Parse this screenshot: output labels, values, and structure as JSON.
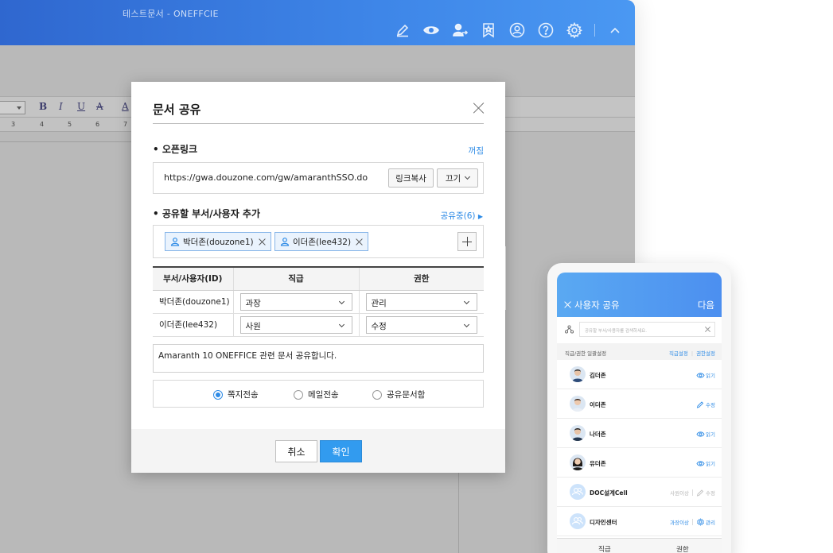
{
  "app": {
    "title": "테스트문서 - ONEFFCIE",
    "toolbar": {
      "bold": "B",
      "italic": "I",
      "underline": "U",
      "strike": "A",
      "font_color": "A"
    },
    "ruler_ticks": [
      "3",
      "4",
      "5",
      "6",
      "7"
    ],
    "header_icons": [
      "edit-icon",
      "view-icon",
      "share-user-icon",
      "bookmark-star-icon",
      "profile-icon",
      "help-icon",
      "settings-icon",
      "collapse-icon"
    ]
  },
  "dialog": {
    "title": "문서 공유",
    "open_link": {
      "label": "오픈링크",
      "status": "꺼짐",
      "url": "https://gwa.douzone.com/gw/amaranthSSO.do",
      "copy_button": "링크복사",
      "toggle_button": "끄기"
    },
    "add_section": {
      "label": "공유할 부서/사용자 추가",
      "sharing_status": "공유중(6)",
      "chips": [
        "박더존(douzone1)",
        "이더존(lee432)"
      ]
    },
    "table": {
      "headers": [
        "부서/사용자(ID)",
        "직급",
        "권한"
      ],
      "rows": [
        {
          "name": "박더존(douzone1)",
          "rank": "과장",
          "permission": "관리"
        },
        {
          "name": "이더존(lee432)",
          "rank": "사원",
          "permission": "수정"
        }
      ]
    },
    "message": "Amaranth 10 ONEFFICE 관련 문서 공유합니다.",
    "send_options": [
      {
        "label": "쪽지전송",
        "selected": true
      },
      {
        "label": "메일전송",
        "selected": false
      },
      {
        "label": "공유문서함",
        "selected": false
      }
    ],
    "cancel_button": "취소",
    "confirm_button": "확인",
    "accent_color": "#329bef"
  },
  "mobile": {
    "title": "사용자 공유",
    "next": "다음",
    "search_placeholder": "공유할 부서/사용자를 검색하세요.",
    "bulk_label": "직급/권한 일괄설정",
    "bulk_rank": "직급설정",
    "bulk_perm": "권한설정",
    "users": [
      {
        "name": "김더존",
        "rank": "",
        "permission": "읽기",
        "icon": "eye-icon"
      },
      {
        "name": "이더존",
        "rank": "",
        "permission": "수정",
        "icon": "pencil-icon"
      },
      {
        "name": "나더존",
        "rank": "",
        "permission": "읽기",
        "icon": "eye-icon"
      },
      {
        "name": "유더존",
        "rank": "",
        "permission": "읽기",
        "icon": "eye-icon"
      },
      {
        "name": "DOC설계Cell",
        "rank": "사원이상",
        "permission": "수정",
        "icon": "pencil-icon"
      },
      {
        "name": "디자인센터",
        "rank": "과장이상",
        "permission": "관리",
        "icon": "gear-icon"
      }
    ],
    "bottom_rank": "직급",
    "bottom_perm": "권한"
  }
}
